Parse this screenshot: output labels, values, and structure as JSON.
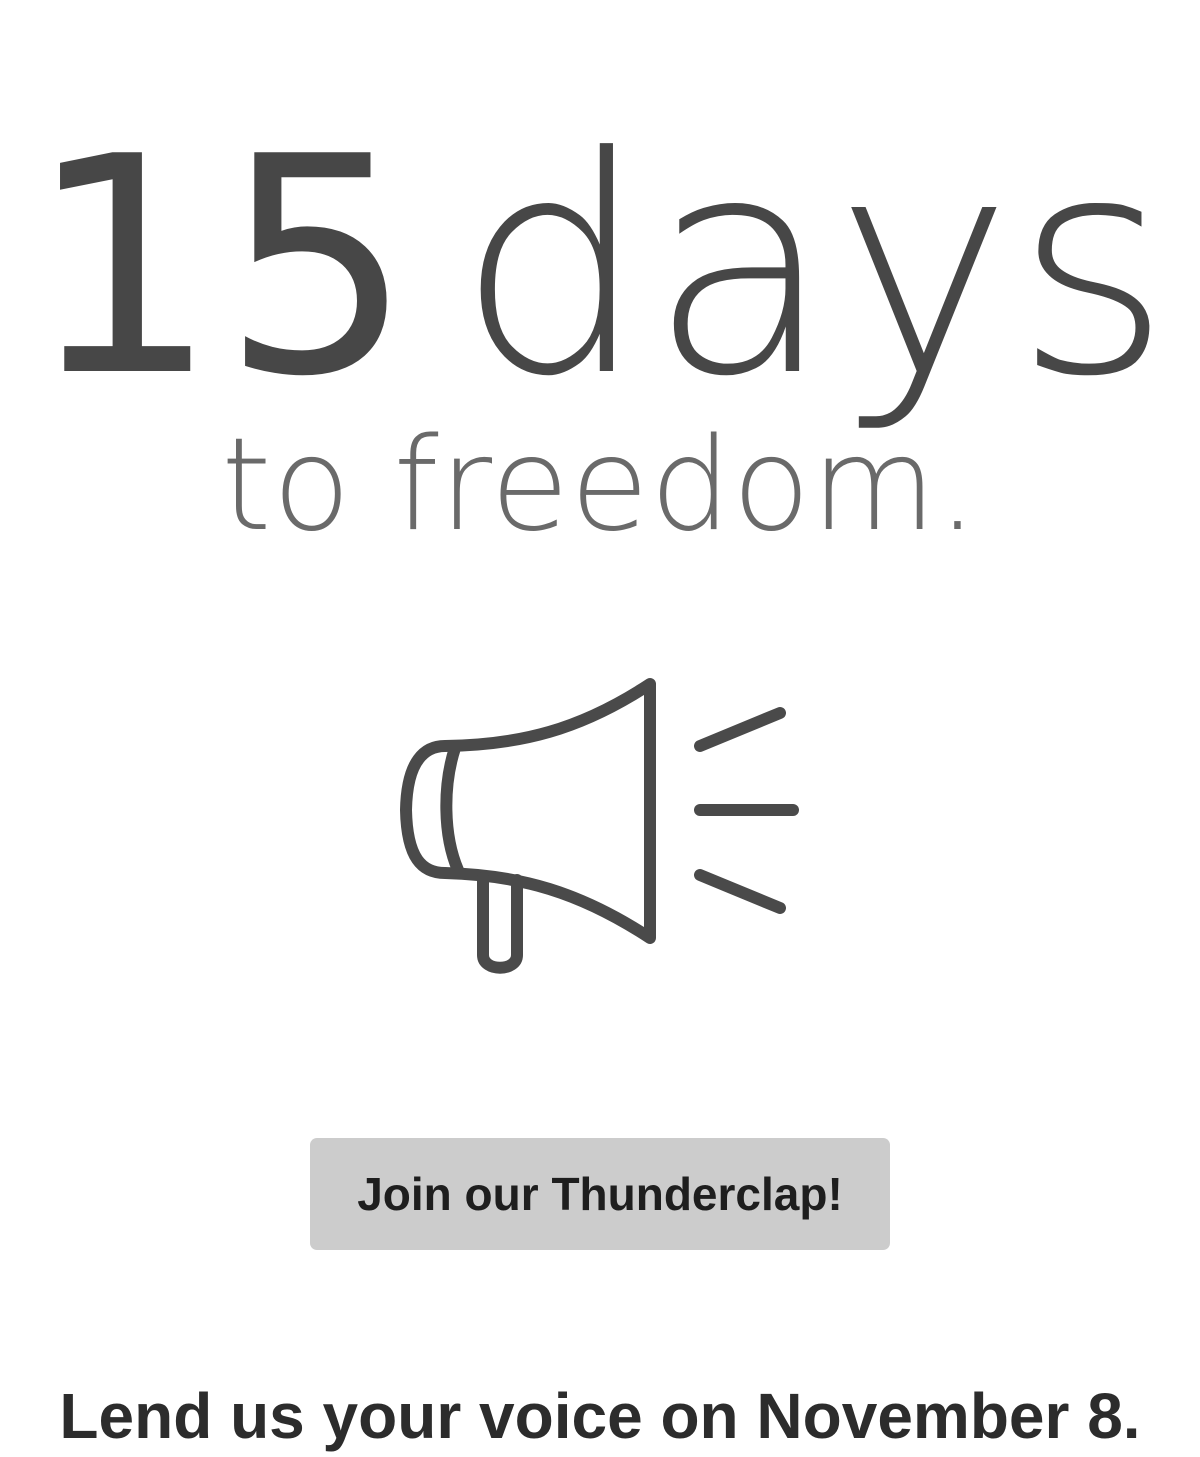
{
  "countdown": {
    "number": "15",
    "unit": "days",
    "subtitle": "to freedom."
  },
  "icon": {
    "name": "megaphone-icon",
    "color": "#4a4a4a"
  },
  "cta": {
    "label": "Join our Thunderclap!",
    "background": "#cccccc"
  },
  "tagline": "Lend us your voice on November 8."
}
